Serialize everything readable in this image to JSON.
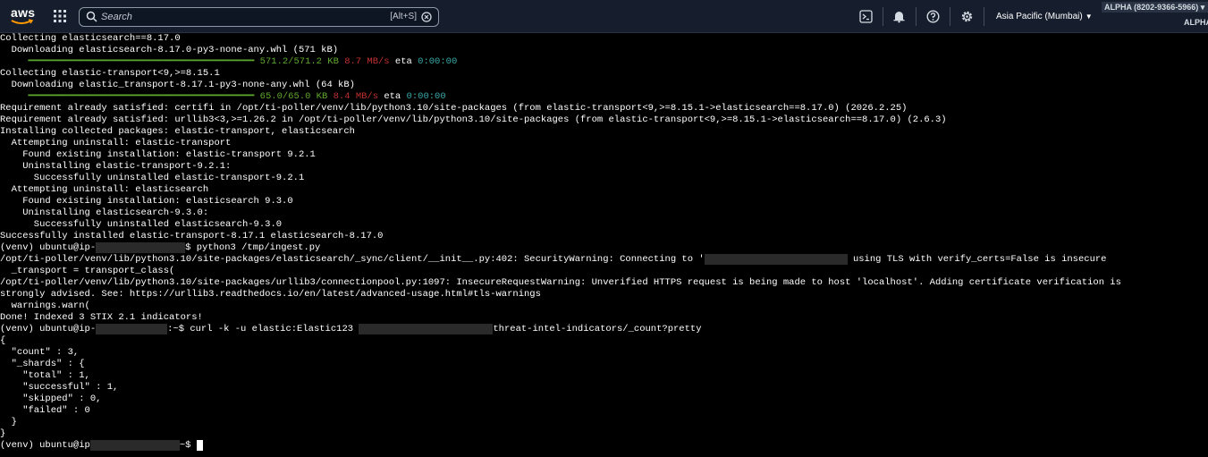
{
  "topbar": {
    "logo_text": "aws",
    "logo_icon": "aws-smile-logo",
    "search_placeholder": "Search",
    "search_shortcut": "[Alt+S]",
    "icons": [
      "grid-icon",
      "search-icon",
      "clear-icon",
      "cloudshell-icon",
      "bell-icon",
      "help-icon",
      "gear-icon"
    ],
    "region": "Asia Pacific (Mumbai)",
    "account": "ALPHA (8202-9366-5966)",
    "account_short": "ALPHA"
  },
  "terminal": {
    "l01": "Collecting elasticsearch==8.17.0",
    "l02": "  Downloading elasticsearch-8.17.0-py3-none-any.whl (571 kB)",
    "l03_bar": "     ━━━━━━━━━━━━━━━━━━━━━━━━━━━━━━━━━━━━━━━━ ",
    "l03_size": "571.2/571.2 KB",
    "l03_speed": "8.7 MB/s",
    "l03_eta_label": " eta ",
    "l03_eta": "0:00:00",
    "l04": "Collecting elastic-transport<9,>=8.15.1",
    "l05": "  Downloading elastic_transport-8.17.1-py3-none-any.whl (64 kB)",
    "l06_bar": "     ━━━━━━━━━━━━━━━━━━━━━━━━━━━━━━━━━━━━━━━━ ",
    "l06_size": "65.0/65.0 KB",
    "l06_speed": "8.4 MB/s",
    "l06_eta_label": " eta ",
    "l06_eta": "0:00:00",
    "l07": "Requirement already satisfied: certifi in /opt/ti-poller/venv/lib/python3.10/site-packages (from elastic-transport<9,>=8.15.1->elasticsearch==8.17.0) (2026.2.25)",
    "l08": "Requirement already satisfied: urllib3<3,>=1.26.2 in /opt/ti-poller/venv/lib/python3.10/site-packages (from elastic-transport<9,>=8.15.1->elasticsearch==8.17.0) (2.6.3)",
    "l09": "Installing collected packages: elastic-transport, elasticsearch",
    "l10": "  Attempting uninstall: elastic-transport",
    "l11": "    Found existing installation: elastic-transport 9.2.1",
    "l12": "    Uninstalling elastic-transport-9.2.1:",
    "l13": "      Successfully uninstalled elastic-transport-9.2.1",
    "l14": "  Attempting uninstall: elasticsearch",
    "l15": "    Found existing installation: elasticsearch 9.3.0",
    "l16": "    Uninstalling elasticsearch-9.3.0:",
    "l17": "      Successfully uninstalled elasticsearch-9.3.0",
    "l18": "Successfully installed elastic-transport-8.17.1 elasticsearch-8.17.0",
    "l19_a": "(venv) ubuntu@ip-",
    "l19_b": "$ python3 /tmp/ingest.py",
    "l20_a": "/opt/ti-poller/venv/lib/python3.10/site-packages/elasticsearch/_sync/client/__init__.py:402: SecurityWarning: Connecting to '",
    "l20_b": " using TLS with verify_certs=False is insecure",
    "l21": "  _transport = transport_class(",
    "l22": "/opt/ti-poller/venv/lib/python3.10/site-packages/urllib3/connectionpool.py:1097: InsecureRequestWarning: Unverified HTTPS request is being made to host 'localhost'. Adding certificate verification is",
    "l23": "strongly advised. See: https://urllib3.readthedocs.io/en/latest/advanced-usage.html#tls-warnings",
    "l24": "  warnings.warn(",
    "l25": "Done! Indexed 3 STIX 2.1 indicators!",
    "l26_a": "(venv) ubuntu@ip-",
    "l26_b": ":~$ curl -k -u elastic:Elastic123 ",
    "l26_c": "threat-intel-indicators/_count?pretty",
    "l27": "{",
    "l28": "  \"count\" : 3,",
    "l29": "  \"_shards\" : {",
    "l30": "    \"total\" : 1,",
    "l31": "    \"successful\" : 1,",
    "l32": "    \"skipped\" : 0,",
    "l33": "    \"failed\" : 0",
    "l34": "  }",
    "l35": "}",
    "l36_a": "(venv) ubuntu@ip",
    "l36_b": "~$ "
  }
}
